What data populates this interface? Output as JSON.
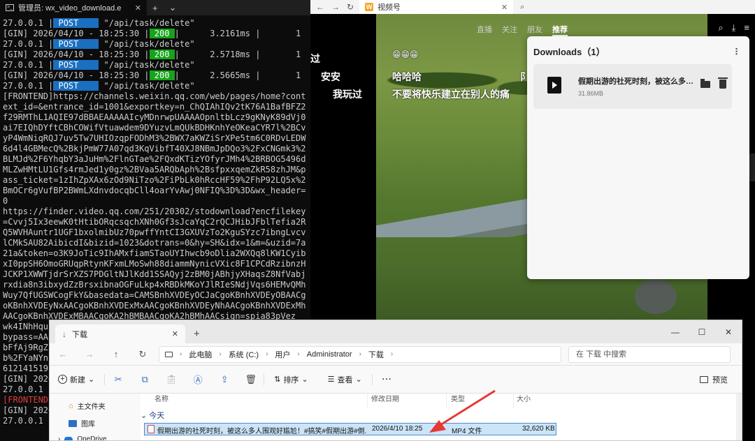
{
  "terminal": {
    "tab_title": "管理员: wx_video_download.e",
    "lines": [
      {
        "kind": "post",
        "prefix": "27.0.0.1 |",
        "method": " POST    ",
        "path": " \"/api/task/delete\""
      },
      {
        "kind": "gin",
        "prefix": "[GIN] 2026/04/10 - 18:25:30 |",
        "status": " 200 ",
        "rest": "|      3.2161ms |       1"
      },
      {
        "kind": "post",
        "prefix": "27.0.0.1 |",
        "method": " POST    ",
        "path": " \"/api/task/delete\""
      },
      {
        "kind": "gin",
        "prefix": "[GIN] 2026/04/10 - 18:25:30 |",
        "status": " 200 ",
        "rest": "|      2.5718ms |       1"
      },
      {
        "kind": "post",
        "prefix": "27.0.0.1 |",
        "method": " POST    ",
        "path": " \"/api/task/delete\""
      },
      {
        "kind": "gin",
        "prefix": "[GIN] 2026/04/10 - 18:25:30 |",
        "status": " 200 ",
        "rest": "|      2.5665ms |       1"
      },
      {
        "kind": "post",
        "prefix": "27.0.0.1 |",
        "method": " POST    ",
        "path": " \"/api/task/delete\""
      }
    ],
    "frontend_url": "[FRONTEND]https://channels.weixin.qq.com/web/pages/home?context_id=&entrance_id=1001&exportkey=n_ChQIAhIQv2tK76A1BafBFZ2f29RMThL1AQIE97dBBAEAAAAAIcyMDnrwpUAAAAOpnltbLcz9gKNyK89dVj0ai7EIQhDYftCBhCOWifVtuawdem9DYuzvLmQUkBDHKnhYeOKeaCYR7l%2BCvyP4WmNiqRQJ7uv5Tw7UHIOzqpFODhM3%2BWX7aKWZiSrXPe5tm6C0RDvLEDW6d4l4GBMecQ%2BkjPmW77A07qd3KqVibfT40XJ8NBmJpDQo3%2FxCNGmk3%2BLMJd%2F6YhqbY3aJuHm%2FlnGTae%2FQxdKTizYOfyrJMh4%2BRBOG5496dMLZwHMtLU1Gfs4rmJed1y0gz%2BVaa5ARQbAph%2BsfpxxqemZkR58zhJM&pass_ticket=1zIhZpXAx6zOd9NiTzo%2FiPbLk0hRccHF59%2FhP92LQ5x%2BmOCr6gVufBP2BWmLXdnvdocqbCll4oarYvAwj0NFIQ%3D%3D&wx_header=0",
    "finder_url": "https://finder.video.qq.com/251/20302/stodownload?encfilekey=Cvvj5Ix3eewK0tHtibORqcsqchXNh0Gf3sJcaYqC2rQCJHibJFblTefia2RQ5WVHAuntr1UGF1bxolmibUz70pwffYntCI3GXUVzTo2KguSYzc7ibngLvcvlCMkSAU82AibicdI&bizid=1023&dotrans=0&hy=SH&idx=1&m=&uzid=7a21a&token=o3K9JoTic9IhAMxfiamSTaoUYIhwcb9oDlia2WXQq8lKW1CyibxI0ppSH6OmoGRUqpRtynKFxmLMoSwh88diammNynicVXic8F1CPCdRzibnzHJCKP1XWWTjdrSrXZS7PDGltNJlKdd1SSAQyj2zBM0jABhjyXHaqsZ8NfVabjrxdia8n3ibxydZzBrsxibnaOGFuLkp4xRBDkMKoYJlRIeSNdjVqs6HEMvQMhWuy7QfUGSWCogFkY&basedata=CAMSBnhXVDEyOCJaCgoKBnhXVDEyOBAACgoKBnhXVDEyNxAACgoKBnhXVDExMxAACgoKBnhXVDEyNhAACgoKBnhXVDExMhAACgoKBnhXVDExMBAACgoKA2hBMBAACgoKA2hBMhAACsign=spia83pVez_",
    "tail": [
      {
        "kind": "plain",
        "text": "wk4INhHqu"
      },
      {
        "kind": "plain",
        "text": "bypass=AA"
      },
      {
        "kind": "plain",
        "text": "bFfAj9RgZ"
      },
      {
        "kind": "plain",
        "text": "b%2FYaNYn"
      },
      {
        "kind": "plain",
        "text": "612141519"
      },
      {
        "kind": "plain",
        "text": "[GIN] 2026"
      },
      {
        "kind": "plain",
        "text": "27.0.0.1 "
      },
      {
        "kind": "red",
        "text": "[FRONTEND"
      },
      {
        "kind": "plain",
        "text": "[GIN] 2026"
      },
      {
        "kind": "plain",
        "text": "27.0.0.1 "
      }
    ]
  },
  "browser": {
    "tab_title": "视频号",
    "nav_tabs": [
      "直播",
      "关注",
      "朋友",
      "推荐"
    ],
    "active_tab": "推荐",
    "danmaku": [
      {
        "text": "过"
      },
      {
        "text": "😁😁😁"
      },
      {
        "text": "安安"
      },
      {
        "text": "哈哈哈"
      },
      {
        "text": "阝"
      },
      {
        "text": "我玩过"
      },
      {
        "text": "不要将快乐建立在别人的痛"
      }
    ]
  },
  "downloads": {
    "title": "Downloads（1）",
    "item": {
      "name": "假期出游的社死时刻，被这么多人围观好尴尬！#搞笑#假期出游#倒霉",
      "size": "31.86MB"
    }
  },
  "explorer": {
    "tab_title": "下载",
    "breadcrumb": [
      "此电脑",
      "系统 (C:)",
      "用户",
      "Administrator",
      "下载"
    ],
    "search_placeholder": "在 下载 中搜索",
    "toolbar": {
      "new_label": "新建",
      "sort_label": "排序",
      "view_label": "查看",
      "more_label": "···",
      "preview_label": "预览"
    },
    "sidebar": [
      "主文件夹",
      "图库",
      "OneDrive"
    ],
    "columns": [
      "名称",
      "修改日期",
      "类型",
      "大小"
    ],
    "group": "今天",
    "file": {
      "name": "假期出游的社死时刻，被这么多人围观好尴尬！#搞笑#假期出游#倒...",
      "date": "2026/4/10 18:25",
      "type": "MP4 文件",
      "size": "32,620 KB"
    }
  },
  "colors": {
    "post_badge": "#1a6fc0",
    "status_200": "#16a31a",
    "frontend_red": "#e03c3c",
    "selection": "#cce4f7",
    "arrow": "#e53935"
  }
}
